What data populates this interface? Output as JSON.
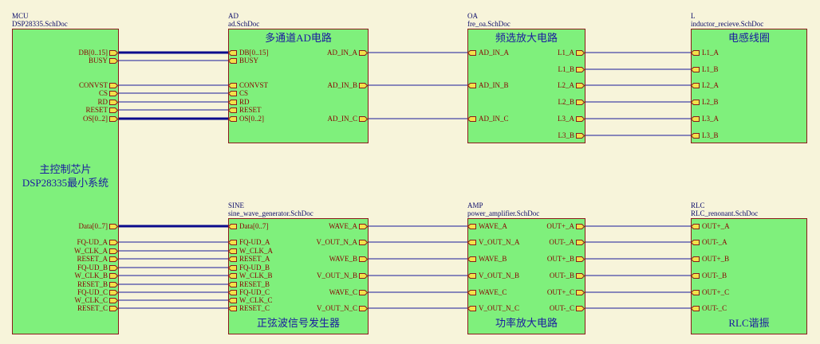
{
  "colors": {
    "wire": "#1a1a99",
    "bus": "#0a0a8c",
    "block": "#7ff07c",
    "port": "#f2e24a",
    "border": "#8b1a1a",
    "bg": "#f7f4da"
  },
  "blocks": [
    {
      "id": "mcu",
      "designator": "MCU",
      "file": "DSP28335.SchDoc",
      "title_lines": [
        "主控制芯片",
        "DSP28335最小系统"
      ]
    },
    {
      "id": "ad",
      "designator": "AD",
      "file": "ad.SchDoc",
      "title_lines": [
        "多通道AD电路"
      ]
    },
    {
      "id": "oa",
      "designator": "OA",
      "file": "fre_oa.SchDoc",
      "title_lines": [
        "频选放大电路"
      ]
    },
    {
      "id": "l",
      "designator": "L",
      "file": "inductor_recieve.SchDoc",
      "title_lines": [
        "电感线圈"
      ]
    },
    {
      "id": "sine",
      "designator": "SINE",
      "file": "sine_wave_generator.SchDoc",
      "title_lines": [
        "正弦波信号发生器"
      ]
    },
    {
      "id": "amp",
      "designator": "AMP",
      "file": "power_amplifier.SchDoc",
      "title_lines": [
        "功率放大电路"
      ]
    },
    {
      "id": "rlc",
      "designator": "RLC",
      "file": "RLC_renonant.SchDoc",
      "title_lines": [
        "RLC谐振"
      ]
    }
  ],
  "ports": {
    "mcu_right": [
      "DB[0..15]",
      "BUSY",
      "CONVST",
      "CS",
      "RD",
      "RESET",
      "OS[0..2]",
      "Data[0..7]",
      "FQ-UD_A",
      "W_CLK_A",
      "RESET_A",
      "FQ-UD_B",
      "W_CLK_B",
      "RESET_B",
      "FQ-UD_C",
      "W_CLK_C",
      "RESET_C"
    ],
    "ad_left": [
      "DB[0..15]",
      "BUSY",
      "CONVST",
      "CS",
      "RD",
      "RESET",
      "OS[0..2]"
    ],
    "ad_right": [
      "AD_IN_A",
      "AD_IN_B",
      "AD_IN_C"
    ],
    "oa_left": [
      "AD_IN_A",
      "AD_IN_B",
      "AD_IN_C"
    ],
    "oa_right": [
      "L1_A",
      "L1_B",
      "L2_A",
      "L2_B",
      "L3_A",
      "L3_B"
    ],
    "l_left": [
      "L1_A",
      "L1_B",
      "L2_A",
      "L2_B",
      "L3_A",
      "L3_B"
    ],
    "sine_left": [
      "Data[0..7]",
      "FQ-UD_A",
      "W_CLK_A",
      "RESET_A",
      "FQ-UD_B",
      "W_CLK_B",
      "RESET_B",
      "FQ-UD_C",
      "W_CLK_C",
      "RESET_C"
    ],
    "sine_right": [
      "WAVE_A",
      "V_OUT_N_A",
      "WAVE_B",
      "V_OUT_N_B",
      "WAVE_C",
      "V_OUT_N_C"
    ],
    "amp_left": [
      "WAVE_A",
      "V_OUT_N_A",
      "WAVE_B",
      "V_OUT_N_B",
      "WAVE_C",
      "V_OUT_N_C"
    ],
    "amp_right": [
      "OUT+_A",
      "OUT-_A",
      "OUT+_B",
      "OUT-_B",
      "OUT+_C",
      "OUT-_C"
    ],
    "rlc_left": [
      "OUT+_A",
      "OUT-_A",
      "OUT+_B",
      "OUT-_B",
      "OUT+_C",
      "OUT-_C"
    ]
  }
}
